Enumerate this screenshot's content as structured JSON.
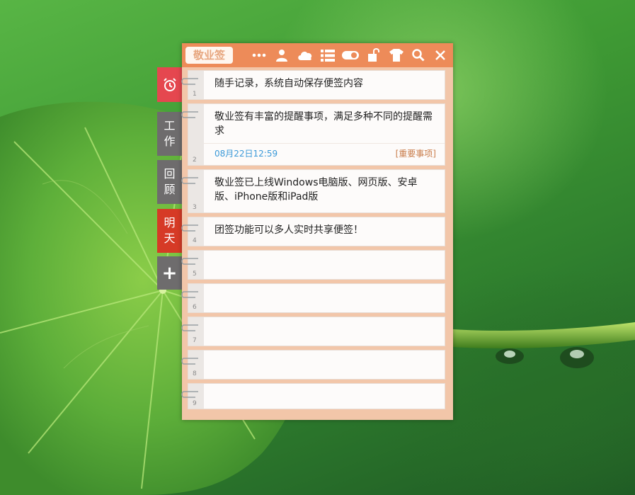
{
  "app": {
    "title": "敬业签"
  },
  "toolbar": {
    "icons": [
      "more-icon",
      "user-icon",
      "cloud-icon",
      "list-icon",
      "toggle-icon",
      "unlock-icon",
      "skin-icon",
      "search-icon",
      "close-icon"
    ]
  },
  "sidebar": {
    "tabs": [
      {
        "name": "alarm",
        "label": "",
        "color": "#e5474f"
      },
      {
        "name": "work",
        "label1": "工",
        "label2": "作",
        "color": "#6e6c6d"
      },
      {
        "name": "review",
        "label1": "回",
        "label2": "顾",
        "color": "#6e6c6d"
      },
      {
        "name": "tomorrow",
        "label1": "明",
        "label2": "天",
        "color": "#d63a26"
      },
      {
        "name": "add",
        "label": "+",
        "color": "#6e6c6d"
      }
    ]
  },
  "notes": [
    {
      "num": "1",
      "text": "随手记录，系统自动保存便签内容"
    },
    {
      "num": "2",
      "text": "敬业签有丰富的提醒事项，满足多种不同的提醒需求",
      "date": "08月22日12:59",
      "tag": "[重要事项]"
    },
    {
      "num": "3",
      "text": "敬业签已上线Windows电脑版、网页版、安卓版、iPhone版和iPad版"
    },
    {
      "num": "4",
      "text": "团签功能可以多人实时共享便签！"
    },
    {
      "num": "5",
      "text": ""
    },
    {
      "num": "6",
      "text": ""
    },
    {
      "num": "7",
      "text": ""
    },
    {
      "num": "8",
      "text": ""
    },
    {
      "num": "9",
      "text": ""
    }
  ],
  "colors": {
    "titlebar": "#ed8b59",
    "accent": "#e5474f",
    "date": "#3a99d8",
    "tag": "#c97c4a"
  }
}
